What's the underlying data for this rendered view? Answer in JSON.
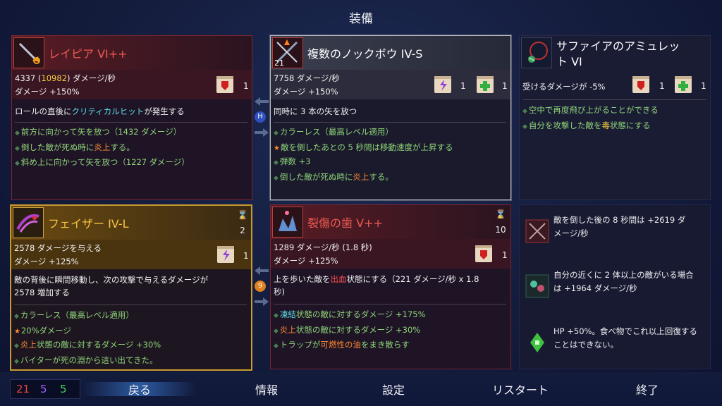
{
  "screen_title": "装備",
  "cards": {
    "rapier": {
      "name": "レイピア VI++",
      "dps_base": "4337 (",
      "dps_crit": "10982",
      "dps_suffix": ") ダメージ/秒",
      "damage": "ダメージ +150%",
      "scroll_count": "1",
      "desc_pre": "ロールの直後に",
      "desc_hl": "クリティカルヒット",
      "desc_post": "が発生する",
      "mods": [
        "前方に向かって矢を放つ（1432 ダメージ）",
        "倒した敵が死ぬ時に",
        "斜め上に向かって矢を放つ（1227 ダメージ）"
      ],
      "mod2_hl": "炎上",
      "mod2_post": "する。"
    },
    "crossbow": {
      "name": "複数のノックボウ IV-S",
      "level": "21",
      "dps": "7758 ダメージ/秒",
      "damage": "ダメージ +150%",
      "scroll1_count": "1",
      "scroll2_count": "1",
      "desc": "同時に 3 本の矢を放つ",
      "mods": [
        "カラーレス（最高レベル適用）",
        "敵を倒したあとの 5 秒間は移動速度が上昇する",
        "弾数 +3",
        "倒した敵が死ぬ時に"
      ],
      "mod4_hl": "炎上",
      "mod4_post": "する。"
    },
    "amulet": {
      "name_line1": "サファイアのアミュレッ",
      "name_line2": "ト VI",
      "stat": "受けるダメージが -5%",
      "scroll1_count": "1",
      "scroll2_count": "1",
      "mods": [
        "空中で再度飛び上がることができる",
        "自分を攻撃した敵を"
      ],
      "mod2_hl": "毒",
      "mod2_post": "状態にする"
    },
    "phaser": {
      "name": "フェイザー IV-L",
      "cooldown": "2",
      "damage_line1": "2578 ダメージを与える",
      "damage_line2": "ダメージ +125%",
      "scroll_count": "1",
      "desc_line1": "敵の背後に瞬間移動し、次の攻撃で与えるダメージが",
      "desc_line2": "2578 増加する",
      "mods": [
        "カラーレス（最高レベル適用）",
        "20%ダメージ",
        "状態の敵に対するダメージ +30%",
        "バイターが死の淵から這い出てきた。"
      ],
      "mod3_hl": "炎上"
    },
    "caltrops": {
      "name": "裂傷の歯 V++",
      "cooldown": "10",
      "dps": "1289 ダメージ/秒 (1.8 秒)",
      "damage": "ダメージ +125%",
      "scroll_count": "1",
      "desc_pre": "上を歩いた敵を",
      "desc_hl": "出血",
      "desc_post": "状態にする（221 ダメージ/秒 x 1.8",
      "desc_line2": "秒)",
      "mods": [
        "状態の敵に対するダメージ +175%",
        "状態の敵に対するダメージ +30%",
        "トラップが",
        "をまき散らす"
      ],
      "mod1_hl": "凍結",
      "mod2_hl": "炎上",
      "mod3_hl": "可燃性の油"
    }
  },
  "mutations": [
    {
      "icon": "crossbow-kill-icon",
      "line1": "敵を倒した後の 8 秒間は +2619 ダ",
      "line2": "メージ/秒"
    },
    {
      "icon": "crowd-icon",
      "line1": "自分の近くに 2 体以上の敵がいる場合",
      "line2": "は +1964 ダメージ/秒"
    },
    {
      "icon": "green-potion-icon",
      "line1": "HP +50%。食べ物でこれ以上回復する",
      "line2": "ことはできない。"
    }
  ],
  "gems": {
    "left_top": "H",
    "left_bottom": "9"
  },
  "scroll_counts": {
    "brutality": "21",
    "tactics": "5",
    "survival": "5"
  },
  "colors": {
    "brutality": "#e84040",
    "tactics": "#a060ff",
    "survival": "#40d060"
  },
  "menu": {
    "back": "戻る",
    "info": "情報",
    "settings": "設定",
    "restart": "リスタート",
    "quit": "終了"
  }
}
